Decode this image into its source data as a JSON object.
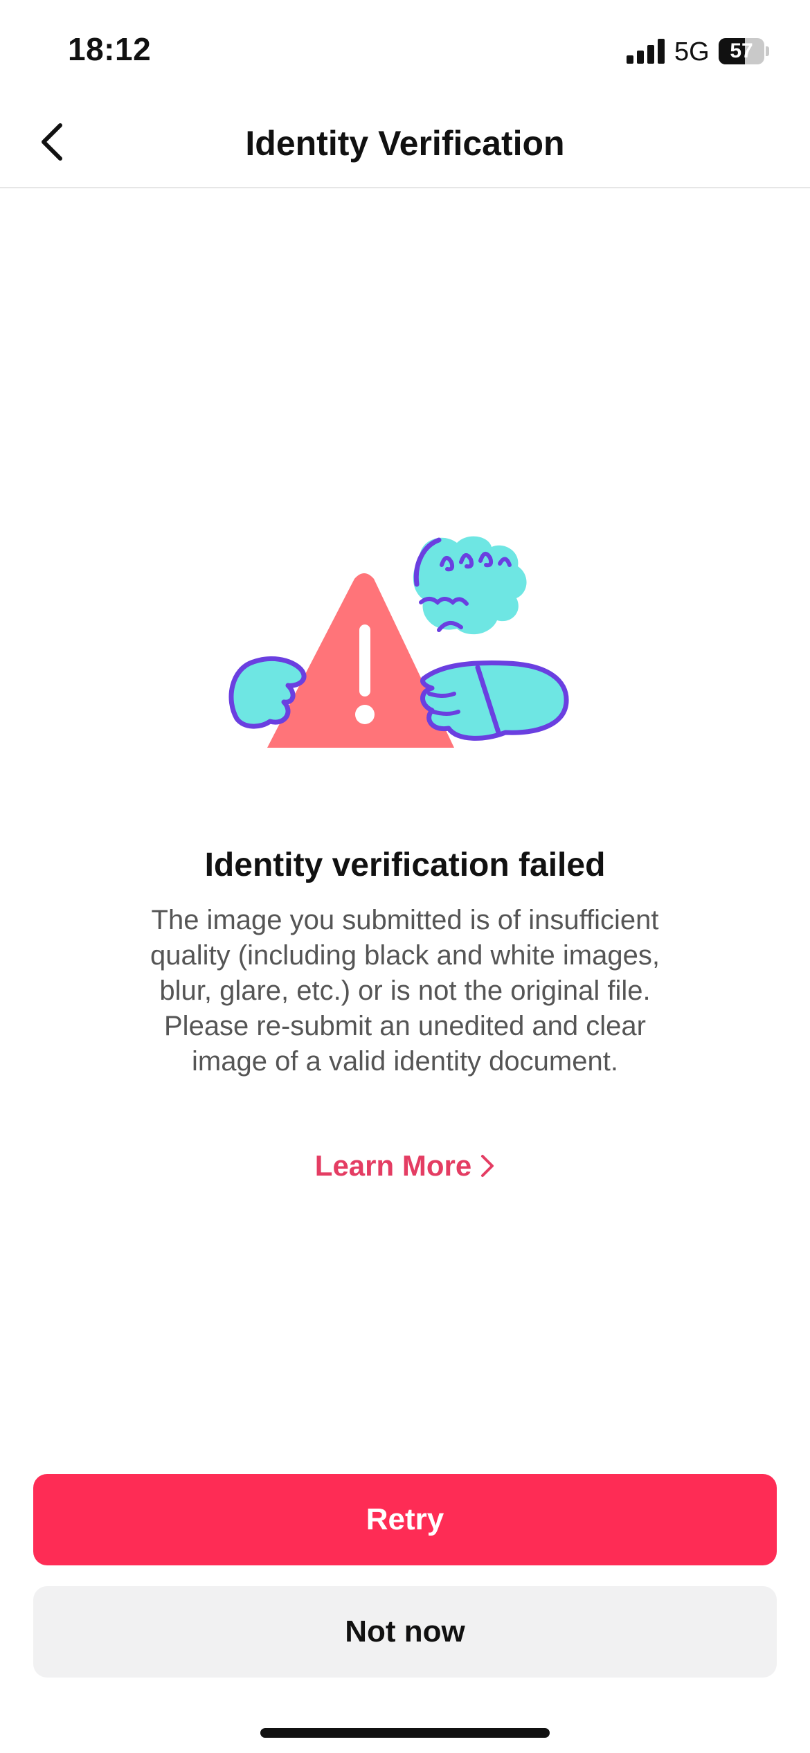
{
  "status_bar": {
    "time": "18:12",
    "network": "5G",
    "battery_level": "57",
    "battery_fraction": 0.57,
    "icons": [
      "signal-icon",
      "battery-icon"
    ]
  },
  "nav": {
    "title": "Identity Verification",
    "back_icon": "chevron-left-icon"
  },
  "illustration": {
    "icon": "warning-triangle-illustration",
    "colors": {
      "triangle": "#ff7479",
      "hands": "#6ee6e3",
      "outline": "#6a3fe0"
    }
  },
  "message": {
    "title": "Identity verification failed",
    "body": "The image you submitted is of insufficient quality (including black and white images, blur, glare, etc.) or is not the original file.  Please re-submit an unedited and clear image of a valid identity document.",
    "learn_more_label": "Learn More",
    "learn_more_icon": "chevron-right-icon"
  },
  "actions": {
    "retry_label": "Retry",
    "not_now_label": "Not now"
  },
  "colors": {
    "primary": "#fe2c55",
    "link": "#e43d63",
    "secondary_button": "#f1f1f2"
  }
}
